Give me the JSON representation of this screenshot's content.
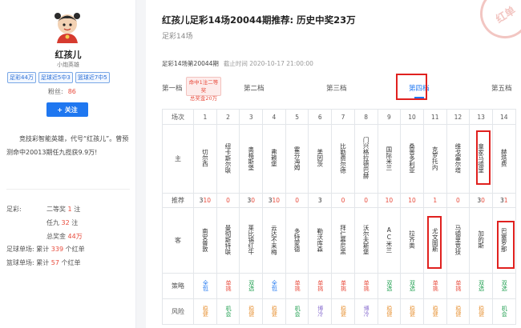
{
  "profile": {
    "name": "红孩儿",
    "title": "小炮英雄",
    "badges": [
      "足彩44万",
      "足球近5中3",
      "篮球近7中5"
    ],
    "fans_label": "粉丝:",
    "fans_count": "86",
    "follow_label": "+ 关注",
    "intro": "竞技彩智能英雄，代号“红孩儿”。曾预测命中20013期任九揽获9.9万!",
    "stats": {
      "zucai_label": "足彩:",
      "second_prize_label": "二等奖",
      "second_prize_count": "1",
      "unit_zhu": "注",
      "renjiu_label": "任九",
      "renjiu_count": "32",
      "total_label": "总奖金",
      "total_amount": "44万",
      "foot_label": "足球单场:",
      "foot_prefix": "累计",
      "foot_count": "339",
      "foot_suffix": "个红单",
      "basket_label": "篮球单场:",
      "basket_prefix": "累计",
      "basket_count": "57",
      "basket_suffix": "个红单"
    }
  },
  "article": {
    "title": "红孩儿足彩14场20044期推荐: 历史中奖23万",
    "subtitle": "足彩14场",
    "issue": "足彩14场第20044期",
    "deadline": "截止时间 2020-10-17 21:00:00",
    "stamp": "红单"
  },
  "tabs": {
    "items": [
      "第一档",
      "第二档",
      "第三档",
      "第四档",
      "第五档"
    ],
    "active": 3,
    "prize_line1": "命中1注二等奖",
    "prize_line2": "总奖金20万"
  },
  "table": {
    "row_labels": [
      "场次",
      "主",
      "推荐",
      "客",
      "策略",
      "风险"
    ],
    "numbers": [
      "1",
      "2",
      "3",
      "4",
      "5",
      "6",
      "7",
      "8",
      "9",
      "10",
      "11",
      "12",
      "13",
      "14"
    ],
    "home": [
      "切尔西",
      "纽卡斯尔联",
      "奥格斯堡",
      "弗赖堡",
      "霍芬海姆",
      "美因茨",
      "比勒费尔德",
      "门兴格拉德巴赫",
      "国际米兰",
      "桑普多利亚",
      "克罗托内",
      "维戈塞尔塔",
      "皇家马德里",
      "赫塔费"
    ],
    "picks": [
      "310",
      "0",
      "30",
      "310",
      "0",
      "3",
      "0",
      "0",
      "10",
      "10",
      "1",
      "0",
      "30",
      "31"
    ],
    "away": [
      "南安普敦",
      "曼彻斯特联",
      "莱比锡红牛",
      "云达不来梅",
      "多特蒙德",
      "勒沃库森",
      "拜仁慕尼黑",
      "沃尔夫斯堡",
      "AC米兰",
      "拉齐奥",
      "尤文图斯",
      "马德里竞技",
      "加的斯",
      "巴塞罗那"
    ],
    "strategy": [
      "全包",
      "单挑",
      "双选",
      "全包",
      "单挑",
      "单挑",
      "单挑",
      "单挑",
      "双选",
      "双选",
      "单挑",
      "单挑",
      "双选",
      "双选"
    ],
    "risk": [
      "稳健",
      "机会",
      "稳健",
      "稳健",
      "机会",
      "博冷",
      "稳健",
      "博冷",
      "稳健",
      "稳健",
      "稳健",
      "稳健",
      "稳健",
      "机会"
    ]
  },
  "colors": {
    "accent": "#1f77f0",
    "red": "#e84b3c",
    "highlight": "#e0211f"
  }
}
